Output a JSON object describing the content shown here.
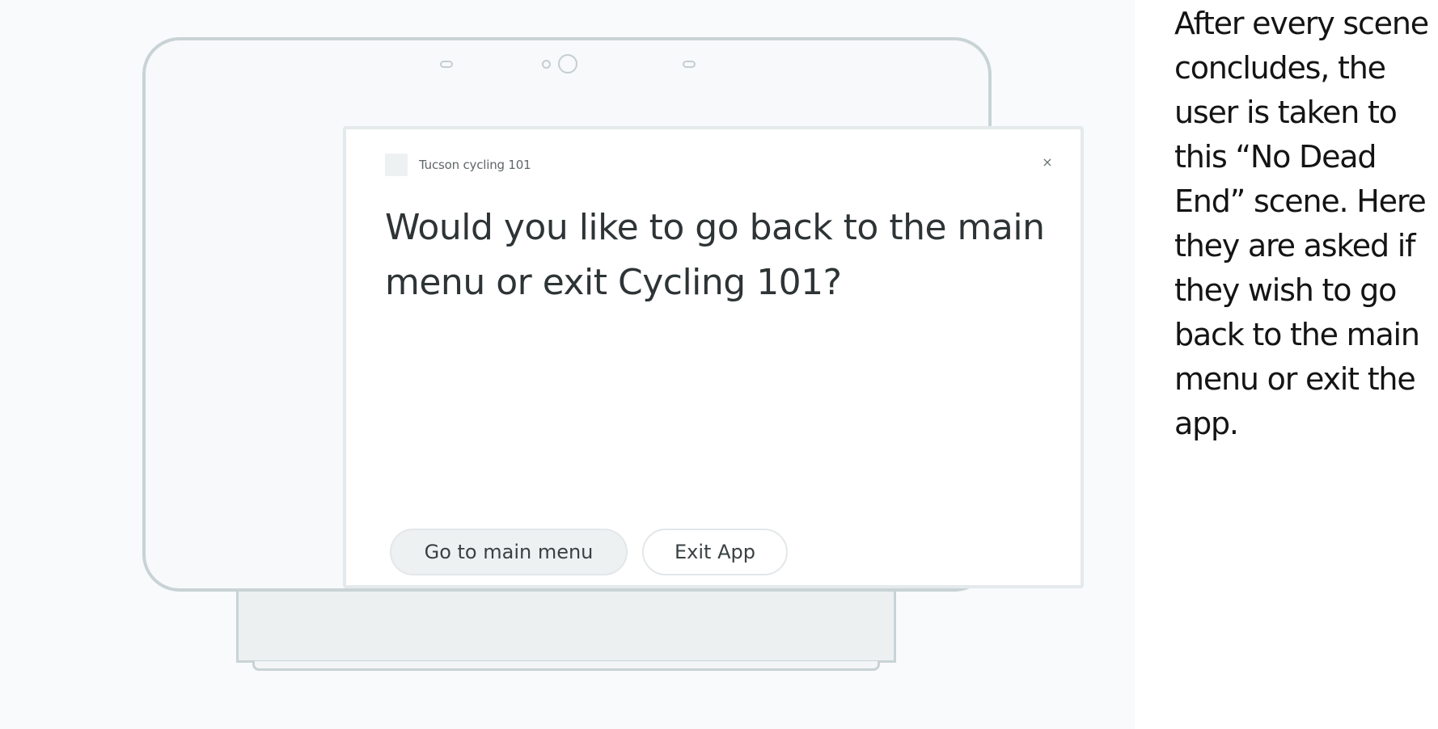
{
  "device": {
    "app_title": "Tucson cycling 101",
    "close_symbol": "×",
    "question": "Would you like to go back to the main menu or exit Cycling 101?",
    "chips": [
      {
        "label": "Go to main menu"
      },
      {
        "label": "Exit App"
      }
    ]
  },
  "caption": {
    "text": "After every scene concludes, the user is taken to this “No Dead End” scene. Here they are asked if they wish to go back to the main menu or exit the app."
  },
  "icons": {
    "close": "close-icon",
    "logo": "app-logo-icon",
    "camera": "camera-icon"
  },
  "colors": {
    "frame_stroke": "#c9d3d6",
    "screen_bg": "#ffffff",
    "chip_fill": "#eef1f2",
    "text": "#2e3436",
    "caption_text": "#141414"
  }
}
